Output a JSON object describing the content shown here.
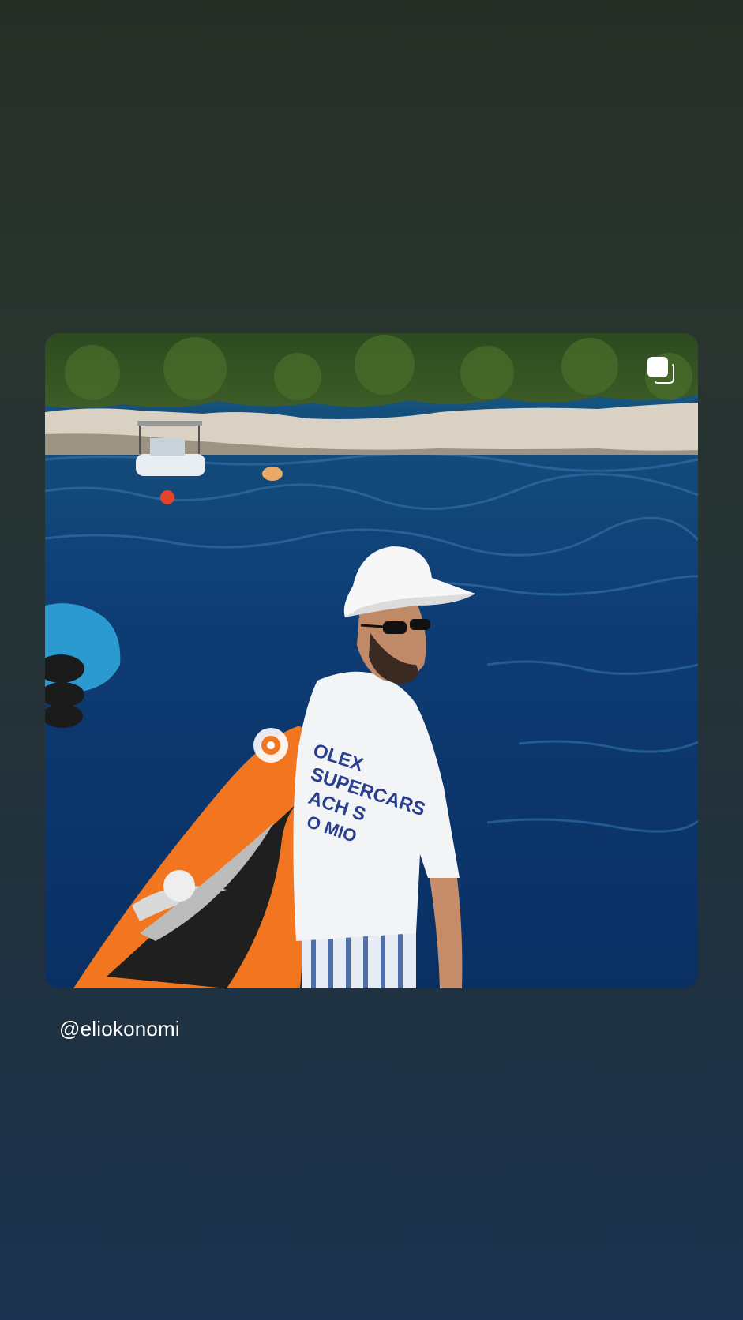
{
  "post": {
    "author_handle": "@eliokonomi",
    "media_type_icon": "multiple-photos-icon",
    "photo_description_icon": "photo"
  },
  "colors": {
    "background_top": "#252d25",
    "background_bottom": "#1b3350",
    "water": "#0e3a6e",
    "paddleboard": "#f2761f",
    "text": "#ffffff"
  }
}
